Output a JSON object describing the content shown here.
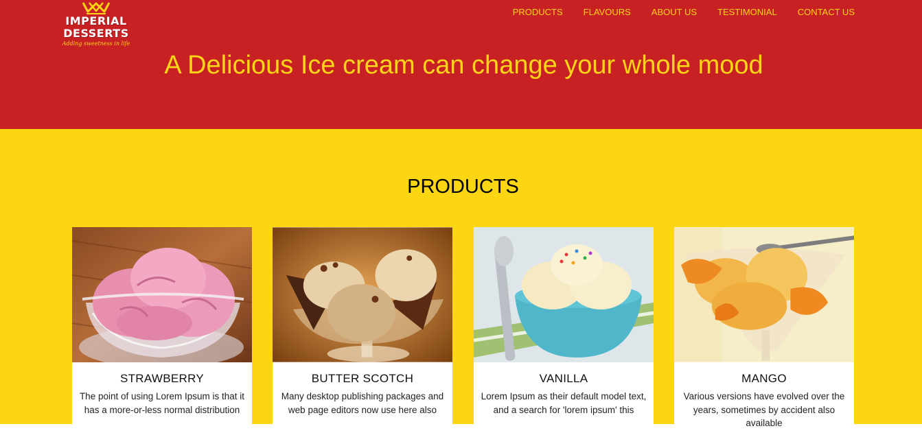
{
  "brand": {
    "line1": "IMPERIAL",
    "line2": "DESSERTS",
    "tagline": "Adding sweetness in life",
    "colors": {
      "header_bg": "#c82124",
      "accent": "#fcd518",
      "section_bg": "#fcd613"
    }
  },
  "nav": {
    "items": [
      "PRODUCTS",
      "FLAVOURS",
      "ABOUT US",
      "TESTIMONIAL",
      "CONTACT US"
    ]
  },
  "hero": {
    "headline": "A Delicious Ice cream can change your whole mood"
  },
  "products": {
    "title": "PRODUCTS",
    "cards": [
      {
        "name": "STRAWBERRY",
        "text": "The point of using Lorem Ipsum is that it has a more-or-less normal distribution",
        "image": "strawberry-ice-cream-image"
      },
      {
        "name": "BUTTER SCOTCH",
        "text": "Many desktop publishing packages and web page editors now use here also",
        "image": "butterscotch-ice-cream-image"
      },
      {
        "name": "VANILLA",
        "text": "Lorem Ipsum as their default model text, and a search for 'lorem ipsum' this",
        "image": "vanilla-ice-cream-image"
      },
      {
        "name": "MANGO",
        "text": "Various versions have evolved over the years, sometimes by accident also available",
        "image": "mango-ice-cream-image"
      }
    ]
  }
}
